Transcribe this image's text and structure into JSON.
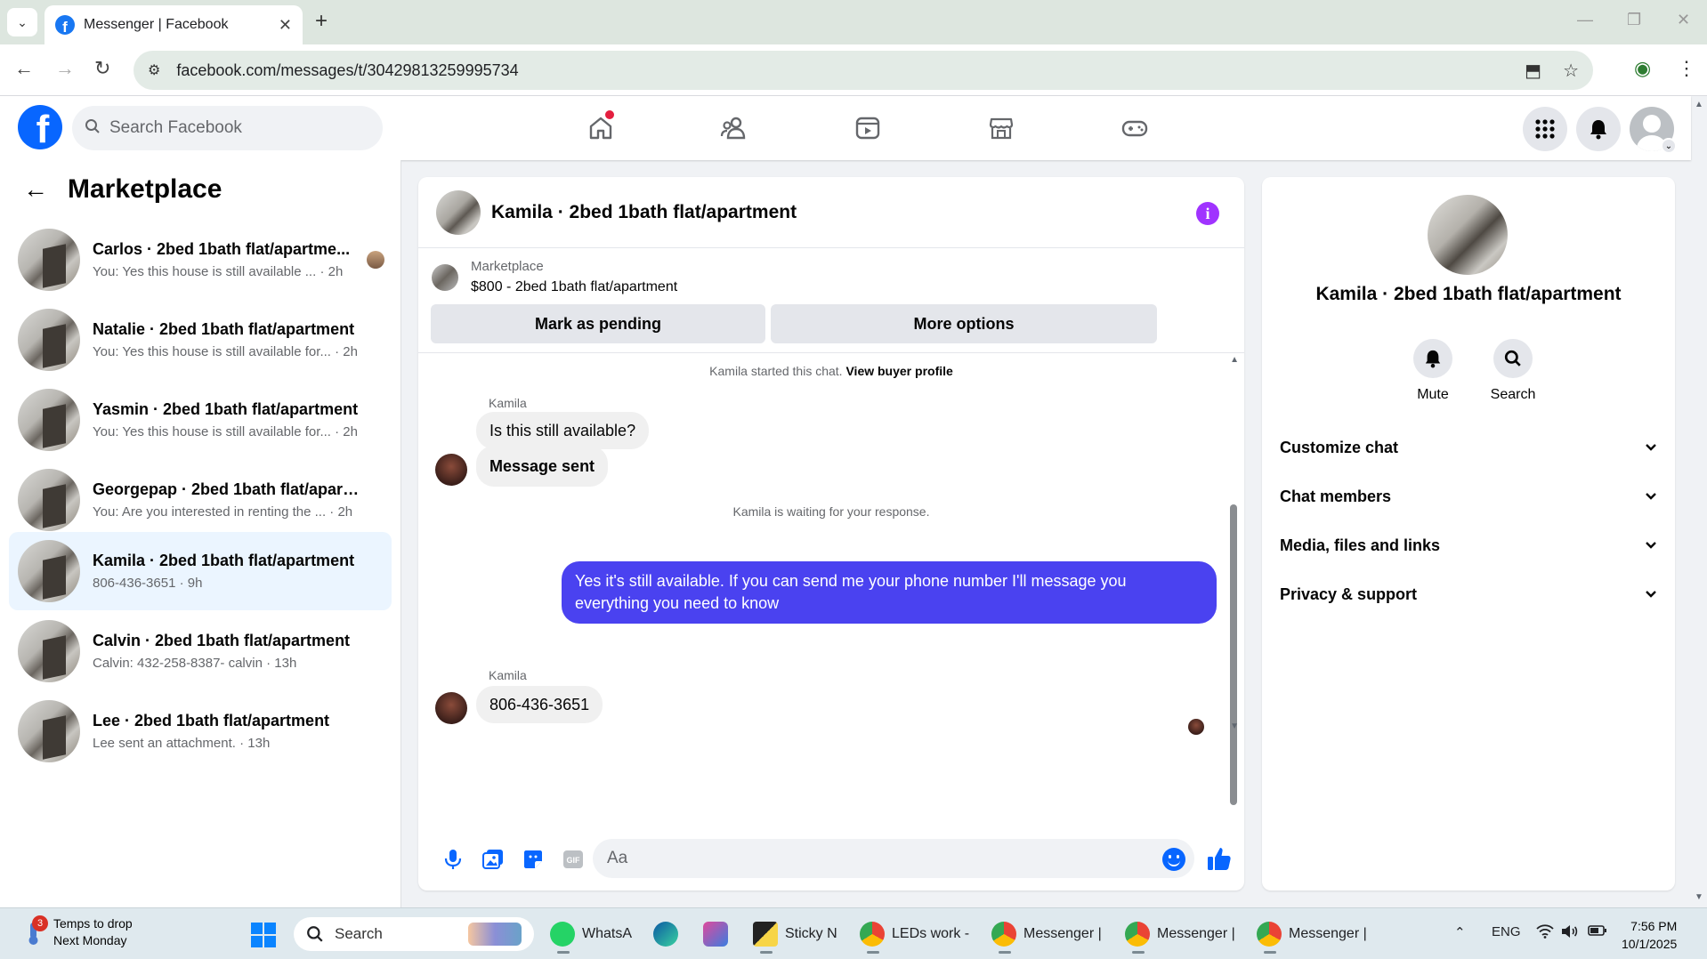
{
  "browser": {
    "tab_title": "Messenger | Facebook",
    "url": "facebook.com/messages/t/30429813259995734"
  },
  "fb": {
    "search_placeholder": "Search Facebook"
  },
  "left_panel": {
    "title": "Marketplace",
    "conversations": [
      {
        "name": "Carlos · 2bed 1bath flat/apartme...",
        "preview": "You: Yes this house is still available ... · 2h"
      },
      {
        "name": "Natalie · 2bed 1bath flat/apartment",
        "preview": "You: Yes this house is still available for... · 2h"
      },
      {
        "name": "Yasmin · 2bed 1bath flat/apartment",
        "preview": "You: Yes this house is still available for... · 2h"
      },
      {
        "name": "Georgepap · 2bed 1bath flat/apart...",
        "preview": "You: Are you interested in renting the ... · 2h"
      },
      {
        "name": "Kamila · 2bed 1bath flat/apartment",
        "preview": "806-436-3651 · 9h"
      },
      {
        "name": "Calvin · 2bed 1bath flat/apartment",
        "preview": "Calvin: 432-258-8387- calvin · 13h"
      },
      {
        "name": "Lee · 2bed 1bath flat/apartment",
        "preview": "Lee sent an attachment. · 13h"
      }
    ]
  },
  "chat": {
    "title": "Kamila · 2bed 1bath flat/apartment",
    "marketplace_label": "Marketplace",
    "listing": "$800 - 2bed 1bath flat/apartment",
    "pending_button": "Mark as pending",
    "more_button": "More options",
    "started_text": "Kamila started this chat.",
    "view_profile": "View buyer profile",
    "sender1": "Kamila",
    "msg1": "Is this still available?",
    "msg2": "Message sent",
    "waiting_text": "Kamila is waiting for your response.",
    "out_msg": "Yes it's still available. If you can send me your phone number I'll message you everything you need to know",
    "sender2": "Kamila",
    "msg3": "806-436-3651",
    "composer_placeholder": "Aa"
  },
  "right_panel": {
    "title": "Kamila · 2bed 1bath flat/apartment",
    "mute_label": "Mute",
    "search_label": "Search",
    "rows": [
      "Customize chat",
      "Chat members",
      "Media, files and links",
      "Privacy & support"
    ]
  },
  "taskbar": {
    "weather_title": "Temps to drop",
    "weather_sub": "Next Monday",
    "weather_badge": "3",
    "search": "Search",
    "apps": [
      "WhatsA",
      "Sticky N",
      "LEDs work -",
      "Messenger |",
      "Messenger |",
      "Messenger |"
    ],
    "lang": "ENG",
    "time": "7:56 PM",
    "date": "10/1/2025"
  },
  "colors": {
    "fb_blue": "#0866ff",
    "outgoing_bubble": "#4a42f0",
    "info_purple": "#a033ff",
    "active_row": "#ebf5ff"
  }
}
